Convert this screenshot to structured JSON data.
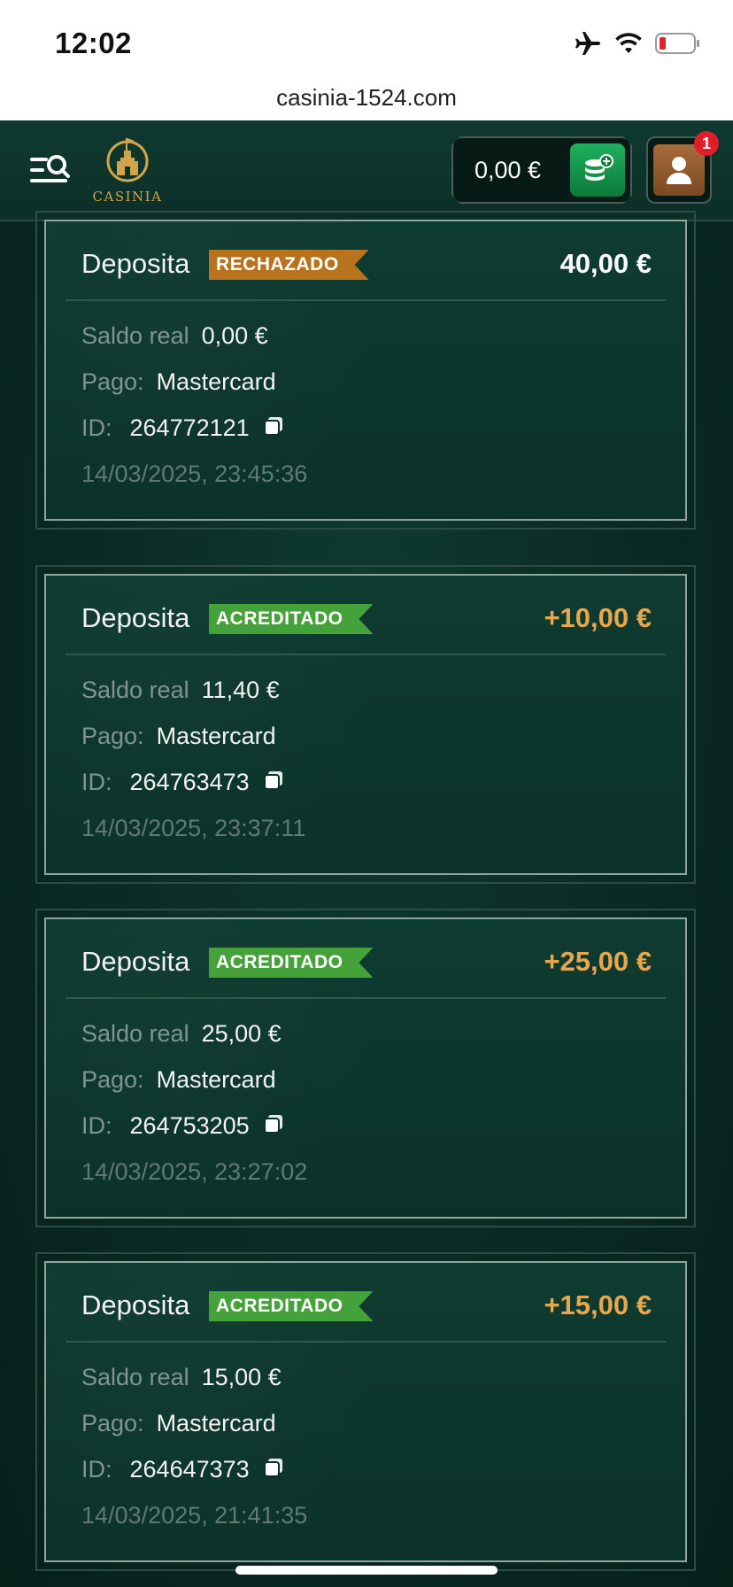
{
  "status_bar": {
    "time": "12:02"
  },
  "browser": {
    "url": "casinia-1524.com"
  },
  "header": {
    "logo_text": "CASINIA",
    "balance": "0,00 €",
    "notification_count": "1"
  },
  "colors": {
    "rejected": "#b8731e",
    "accepted": "#45a23a",
    "gold_amount": "#e8a74a",
    "header_bg": "#0f3a2f"
  },
  "labels": {
    "real_balance": "Saldo real",
    "payment": "Pago:",
    "id": "ID:"
  },
  "transactions": [
    {
      "type": "Deposita",
      "status": "RECHAZADO",
      "amount": "40,00 €",
      "real_balance": "0,00 €",
      "payment": "Mastercard",
      "id": "264772121",
      "datetime": "14/03/2025, 23:45:36"
    },
    {
      "type": "Deposita",
      "status": "ACREDITADO",
      "amount": "+10,00 €",
      "real_balance": "11,40 €",
      "payment": "Mastercard",
      "id": "264763473",
      "datetime": "14/03/2025, 23:37:11"
    },
    {
      "type": "Deposita",
      "status": "ACREDITADO",
      "amount": "+25,00 €",
      "real_balance": "25,00 €",
      "payment": "Mastercard",
      "id": "264753205",
      "datetime": "14/03/2025, 23:27:02"
    },
    {
      "type": "Deposita",
      "status": "ACREDITADO",
      "amount": "+15,00 €",
      "real_balance": "15,00 €",
      "payment": "Mastercard",
      "id": "264647373",
      "datetime": "14/03/2025, 21:41:35"
    }
  ]
}
